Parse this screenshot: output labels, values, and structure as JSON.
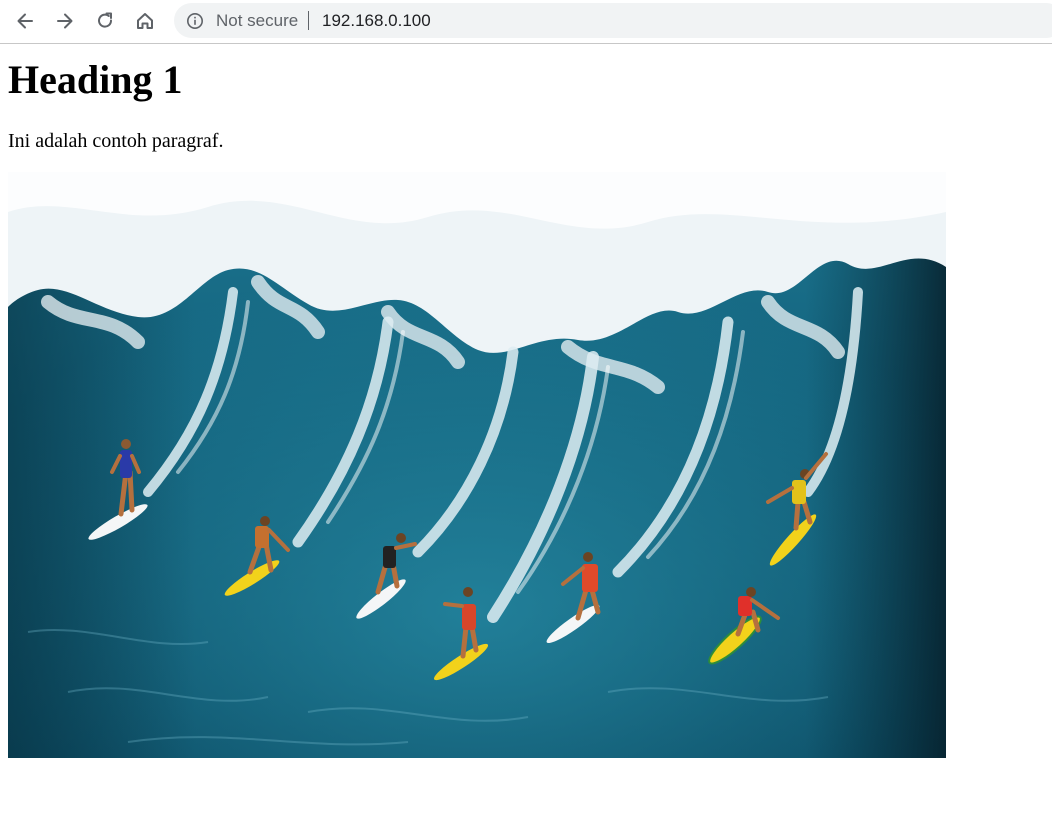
{
  "browser": {
    "nav": {
      "back_icon": "arrow-left-icon",
      "forward_icon": "arrow-right-icon",
      "reload_icon": "reload-icon",
      "home_icon": "home-icon"
    },
    "omnibox": {
      "security_icon": "info-circle-icon",
      "security_label": "Not secure",
      "url": "192.168.0.100"
    }
  },
  "page": {
    "heading": "Heading 1",
    "paragraph": "Ini adalah contoh paragraf.",
    "image": {
      "subject": "surfers riding a large ocean wave"
    }
  },
  "colors": {
    "omnibox_bg": "#f1f3f4",
    "icon_gray": "#5f6368",
    "ocean_deep": "#0d4a63",
    "ocean_mid": "#1a7a96",
    "foam": "#eef4f7",
    "surfboard_yellow": "#f2d21b"
  }
}
